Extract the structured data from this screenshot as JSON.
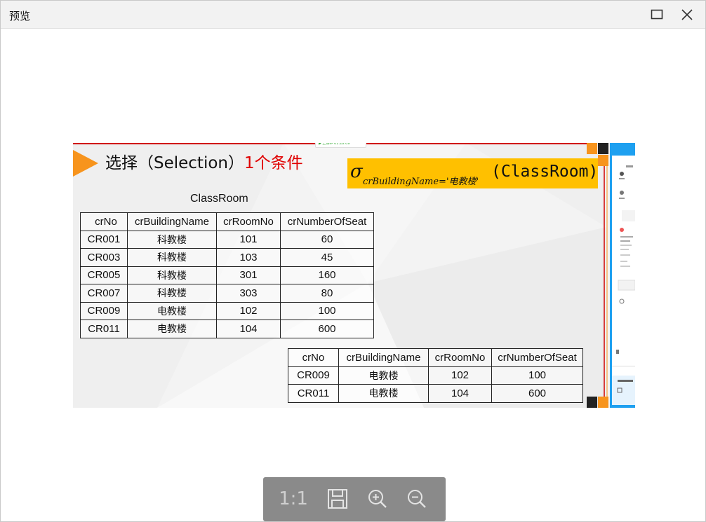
{
  "window": {
    "title": "预览",
    "maximize_icon": "maximize-icon",
    "close_icon": "close-icon"
  },
  "slide": {
    "heading_prefix": "选择（Selection）",
    "heading_highlight": "1个条件",
    "formula": {
      "sigma": "σ",
      "subscript": "crBuildingName='电教楼'",
      "relation": "(ClassRoom)"
    },
    "table_caption": "ClassRoom",
    "source_table": {
      "headers": [
        "crNo",
        "crBuildingName",
        "crRoomNo",
        "crNumberOfSeat"
      ],
      "rows": [
        [
          "CR001",
          "科教楼",
          "101",
          "60"
        ],
        [
          "CR003",
          "科教楼",
          "103",
          "45"
        ],
        [
          "CR005",
          "科教楼",
          "301",
          "160"
        ],
        [
          "CR007",
          "科教楼",
          "303",
          "80"
        ],
        [
          "CR009",
          "电教楼",
          "102",
          "100"
        ],
        [
          "CR011",
          "电教楼",
          "104",
          "600"
        ]
      ]
    },
    "result_table": {
      "headers": [
        "crNo",
        "crBuildingName",
        "crRoomNo",
        "crNumberOfSeat"
      ],
      "rows": [
        [
          "CR009",
          "电教楼",
          "102",
          "100"
        ],
        [
          "CR011",
          "电教楼",
          "104",
          "600"
        ]
      ]
    },
    "accent_colors": {
      "orange": "#f7941d",
      "red": "#e00000",
      "formula_bg": "#ffc000",
      "side_blue": "#1ea0f0"
    }
  },
  "toolbar": {
    "actual_size_label": "1:1",
    "save_icon": "save-icon",
    "zoom_in_icon": "zoom-in-icon",
    "zoom_out_icon": "zoom-out-icon"
  }
}
